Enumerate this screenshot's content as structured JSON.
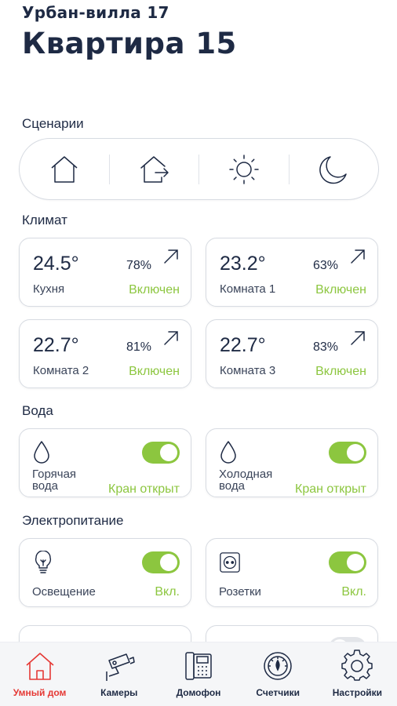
{
  "header": {
    "subtitle": "Урбан-вилла 17",
    "title": "Квартира 15"
  },
  "scenarios": {
    "label": "Сценарии",
    "items": [
      {
        "icon": "home-icon"
      },
      {
        "icon": "leave-home-icon"
      },
      {
        "icon": "sun-icon"
      },
      {
        "icon": "moon-icon"
      }
    ]
  },
  "climate": {
    "label": "Климат",
    "cards": [
      {
        "temp": "24.5°",
        "humidity": "78%",
        "room": "Кухня",
        "status": "Включен"
      },
      {
        "temp": "23.2°",
        "humidity": "63%",
        "room": "Комната 1",
        "status": "Включен"
      },
      {
        "temp": "22.7°",
        "humidity": "81%",
        "room": "Комната 2",
        "status": "Включен"
      },
      {
        "temp": "22.7°",
        "humidity": "83%",
        "room": "Комната 3",
        "status": "Включен"
      }
    ]
  },
  "water": {
    "label": "Вода",
    "cards": [
      {
        "name_line1": "Горячая",
        "name_line2": "вода",
        "status": "Кран открыт",
        "on": true,
        "icon": "water-drop-icon"
      },
      {
        "name_line1": "Холодная",
        "name_line2": "вода",
        "status": "Кран открыт",
        "on": true,
        "icon": "water-drop-icon"
      }
    ]
  },
  "power": {
    "label": "Электропитание",
    "cards": [
      {
        "name": "Освещение",
        "status": "Вкл.",
        "on": true,
        "icon": "lightbulb-icon"
      },
      {
        "name": "Розетки",
        "status": "Вкл.",
        "on": true,
        "icon": "socket-icon"
      }
    ]
  },
  "tabbar": {
    "tabs": [
      {
        "label": "Умный дом",
        "icon": "smart-home-icon",
        "active": true
      },
      {
        "label": "Камеры",
        "icon": "camera-icon",
        "active": false
      },
      {
        "label": "Домофон",
        "icon": "intercom-icon",
        "active": false
      },
      {
        "label": "Счетчики",
        "icon": "meter-icon",
        "active": false
      },
      {
        "label": "Настройки",
        "icon": "settings-icon",
        "active": false
      }
    ]
  },
  "colors": {
    "primary": "#1e2a44",
    "accent_green": "#8cc63f",
    "active_red": "#e53935",
    "border": "#d7dbe2"
  }
}
